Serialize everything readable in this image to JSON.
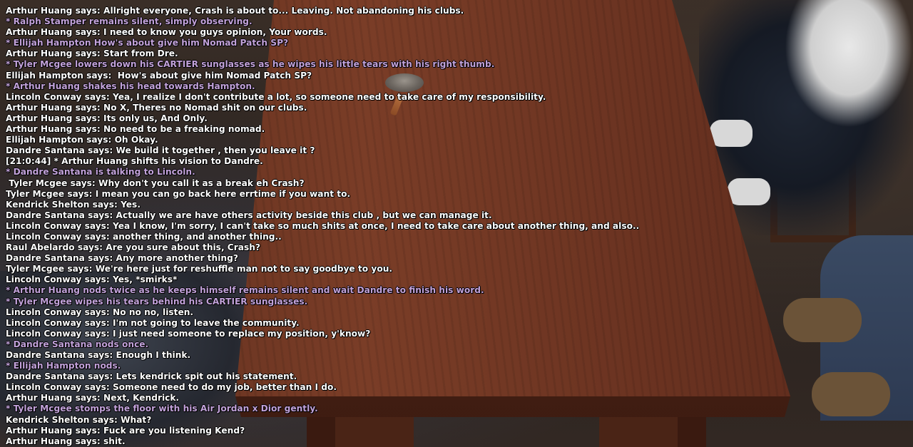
{
  "colors": {
    "say": "#ffffff",
    "action": "#c2a2da",
    "table": "#7a3d27"
  },
  "chat": [
    {
      "type": "say",
      "text": "Arthur Huang says: Allright everyone, Crash is about to... Leaving. Not abandoning his clubs."
    },
    {
      "type": "me",
      "text": "* Ralph Stamper remains silent, simply observing."
    },
    {
      "type": "say",
      "text": "Arthur Huang says: I need to know you guys opinion, Your words."
    },
    {
      "type": "me",
      "text": "* Ellijah Hampton How's about give him Nomad Patch SP?"
    },
    {
      "type": "say",
      "text": "Arthur Huang says: Start from Dre."
    },
    {
      "type": "me",
      "text": "* Tyler Mcgee lowers down his CARTIER sunglasses as he wipes his little tears with his right thumb."
    },
    {
      "type": "say",
      "text": "Ellijah Hampton says:  How's about give him Nomad Patch SP?"
    },
    {
      "type": "me",
      "text": "* Arthur Huang shakes his head towards Hampton."
    },
    {
      "type": "say",
      "text": "Lincoln Conway says: Yea, I realize I don't contribute a lot, so someone need to take care of my responsibility."
    },
    {
      "type": "say",
      "text": "Arthur Huang says: No X, Theres no Nomad shit on our clubs."
    },
    {
      "type": "say",
      "text": "Arthur Huang says: Its only us, And Only."
    },
    {
      "type": "say",
      "text": "Arthur Huang says: No need to be a freaking nomad."
    },
    {
      "type": "say",
      "text": "Ellijah Hampton says: Oh Okay."
    },
    {
      "type": "say",
      "text": "Dandre Santana says: We build it together , then you leave it ?"
    },
    {
      "type": "say",
      "text": "[21:0:44] * Arthur Huang shifts his vision to Dandre."
    },
    {
      "type": "me",
      "text": "* Dandre Santana is talking to Lincoln."
    },
    {
      "type": "say",
      "text": " Tyler Mcgee says: Why don't you call it as a break eh Crash?"
    },
    {
      "type": "say",
      "text": "Tyler Mcgee says: I mean you can go back here errtime if you want to."
    },
    {
      "type": "say",
      "text": "Kendrick Shelton says: Yes."
    },
    {
      "type": "say",
      "text": "Dandre Santana says: Actually we are have others activity beside this club , but we can manage it."
    },
    {
      "type": "say",
      "text": "Lincoln Conway says: Yea I know, I'm sorry, I can't take so much shits at once, I need to take care about another thing, and also.."
    },
    {
      "type": "say",
      "text": "Lincoln Conway says: another thing, and another thing.."
    },
    {
      "type": "say",
      "text": "Raul Abelardo says: Are you sure about this, Crash?"
    },
    {
      "type": "say",
      "text": "Dandre Santana says: Any more another thing?"
    },
    {
      "type": "say",
      "text": "Tyler Mcgee says: We're here just for reshuffle man not to say goodbye to you."
    },
    {
      "type": "say",
      "text": "Lincoln Conway says: Yes, *smirks*"
    },
    {
      "type": "me",
      "text": "* Arthur Huang nods twice as he keeps himself remains silent and wait Dandre to finish his word."
    },
    {
      "type": "me",
      "text": "* Tyler Mcgee wipes his tears behind his CARTIER sunglasses."
    },
    {
      "type": "say",
      "text": "Lincoln Conway says: No no no, listen."
    },
    {
      "type": "say",
      "text": "Lincoln Conway says: I'm not going to leave the community."
    },
    {
      "type": "say",
      "text": "Lincoln Conway says: I just need someone to replace my position, y'know?"
    },
    {
      "type": "me",
      "text": "* Dandre Santana nods once."
    },
    {
      "type": "say",
      "text": "Dandre Santana says: Enough I think."
    },
    {
      "type": "me",
      "text": "* Ellijah Hampton nods."
    },
    {
      "type": "say",
      "text": "Dandre Santana says: Lets kendrick spit out his statement."
    },
    {
      "type": "say",
      "text": "Lincoln Conway says: Someone need to do my job, better than I do."
    },
    {
      "type": "say",
      "text": "Arthur Huang says: Next, Kendrick."
    },
    {
      "type": "me",
      "text": "* Tyler Mcgee stomps the floor with his Air Jordan x Dior gently."
    },
    {
      "type": "say",
      "text": "Kendrick Shelton says: What?"
    },
    {
      "type": "say",
      "text": "Arthur Huang says: Fuck are you listening Kend?"
    },
    {
      "type": "say",
      "text": "Arthur Huang says: shit."
    }
  ]
}
